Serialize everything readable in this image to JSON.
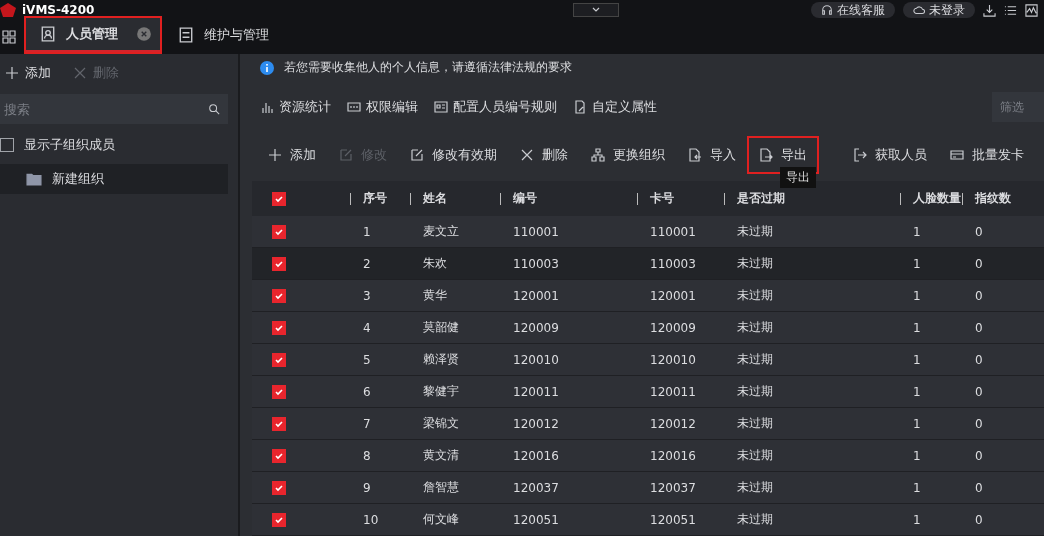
{
  "app_title": "iVMS-4200",
  "top_buttons": [
    {
      "label": "在线客服"
    },
    {
      "label": "未登录"
    }
  ],
  "tabs": [
    {
      "label": "人员管理",
      "selected": true,
      "highlighted": true
    },
    {
      "label": "维护与管理",
      "selected": false,
      "highlighted": false
    }
  ],
  "org_toolbar": [
    {
      "label": "添加",
      "disabled": false
    },
    {
      "label": "删除",
      "disabled": true
    }
  ],
  "org_search": {
    "placeholder": "搜索"
  },
  "show_sub_members": {
    "label": "显示子组织成员",
    "checked": false
  },
  "org_tree": [
    {
      "label": "新建组织",
      "selected": true
    }
  ],
  "notice": "若您需要收集他人的个人信息，请遵循法律法规的要求",
  "tools": [
    {
      "label": "资源统计"
    },
    {
      "label": "权限编辑"
    },
    {
      "label": "配置人员编号规则"
    },
    {
      "label": "自定义属性"
    }
  ],
  "filter": {
    "placeholder": "筛选"
  },
  "actions": [
    {
      "label": "添加",
      "disabled": false,
      "highlighted": false
    },
    {
      "label": "修改",
      "disabled": true,
      "highlighted": false
    },
    {
      "label": "修改有效期",
      "disabled": false,
      "highlighted": false
    },
    {
      "label": "删除",
      "disabled": false,
      "highlighted": false
    },
    {
      "label": "更换组织",
      "disabled": false,
      "highlighted": false
    },
    {
      "label": "导入",
      "disabled": false,
      "highlighted": false
    },
    {
      "label": "导出",
      "disabled": false,
      "highlighted": true
    },
    {
      "label": "获取人员",
      "disabled": false,
      "highlighted": false
    },
    {
      "label": "批量发卡",
      "disabled": false,
      "highlighted": false
    }
  ],
  "tooltip": "导出",
  "table": {
    "all_checked": true,
    "columns": [
      "序号",
      "姓名",
      "编号",
      "卡号",
      "是否过期",
      "人脸数量",
      "指纹数"
    ],
    "rows": [
      {
        "checked": true,
        "hovered": false,
        "cells": [
          "1",
          "麦文立",
          "110001",
          "110001",
          "未过期",
          "1",
          "0"
        ]
      },
      {
        "checked": true,
        "hovered": true,
        "cells": [
          "2",
          "朱欢",
          "110003",
          "110003",
          "未过期",
          "1",
          "0"
        ]
      },
      {
        "checked": true,
        "hovered": false,
        "cells": [
          "3",
          "黄华",
          "120001",
          "120001",
          "未过期",
          "1",
          "0"
        ]
      },
      {
        "checked": true,
        "hovered": false,
        "cells": [
          "4",
          "莫韶健",
          "120009",
          "120009",
          "未过期",
          "1",
          "0"
        ]
      },
      {
        "checked": true,
        "hovered": false,
        "cells": [
          "5",
          "赖泽贤",
          "120010",
          "120010",
          "未过期",
          "1",
          "0"
        ]
      },
      {
        "checked": true,
        "hovered": false,
        "cells": [
          "6",
          "黎健宇",
          "120011",
          "120011",
          "未过期",
          "1",
          "0"
        ]
      },
      {
        "checked": true,
        "hovered": false,
        "cells": [
          "7",
          "梁锦文",
          "120012",
          "120012",
          "未过期",
          "1",
          "0"
        ]
      },
      {
        "checked": true,
        "hovered": false,
        "cells": [
          "8",
          "黄文清",
          "120016",
          "120016",
          "未过期",
          "1",
          "0"
        ]
      },
      {
        "checked": true,
        "hovered": false,
        "cells": [
          "9",
          "詹智慧",
          "120037",
          "120037",
          "未过期",
          "1",
          "0"
        ]
      },
      {
        "checked": true,
        "hovered": false,
        "cells": [
          "10",
          "何文峰",
          "120051",
          "120051",
          "未过期",
          "1",
          "0"
        ]
      }
    ]
  }
}
